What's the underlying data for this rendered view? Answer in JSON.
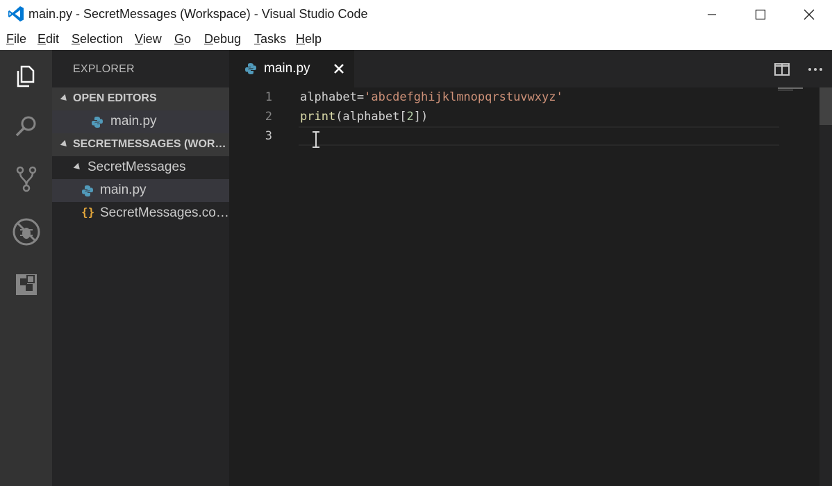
{
  "window": {
    "title": "main.py - SecretMessages (Workspace) - Visual Studio Code"
  },
  "menu": {
    "items": [
      {
        "first": "F",
        "rest": "ile"
      },
      {
        "first": "E",
        "rest": "dit"
      },
      {
        "first": "S",
        "rest": "election"
      },
      {
        "first": "V",
        "rest": "iew"
      },
      {
        "first": "G",
        "rest": "o"
      },
      {
        "first": "D",
        "rest": "ebug"
      },
      {
        "first": "T",
        "rest": "asks"
      },
      {
        "first": "H",
        "rest": "elp"
      }
    ]
  },
  "sidebar": {
    "title": "EXPLORER",
    "open_editors": {
      "header": "OPEN EDITORS",
      "files": [
        "main.py"
      ]
    },
    "workspace": {
      "header": "SECRETMESSAGES (WORKSPACE)",
      "folder": "SecretMessages",
      "files": [
        "main.py",
        "SecretMessages.code-workspace"
      ]
    }
  },
  "editor": {
    "tab_label": "main.py",
    "lines": [
      {
        "num": "1",
        "var": "alphabet",
        "op": "=",
        "str": "'abcdefghijklmnopqrstuvwxyz'"
      },
      {
        "num": "2",
        "fn": "print",
        "open": "(alphabet[",
        "num_lit": "2",
        "close": "])"
      },
      {
        "num": "3"
      }
    ]
  },
  "colors": {
    "activity_bar": "#333333",
    "sidebar": "#252526",
    "editor_bg": "#1e1e1e",
    "string": "#ce9178",
    "python_icon": "#519aba",
    "json_icon": "#e5a83b"
  },
  "icons": {
    "activity": [
      "files-icon",
      "search-icon",
      "source-control-icon",
      "debug-icon",
      "extensions-icon"
    ],
    "file_python": "python-file-icon",
    "file_json": "json-file-icon"
  }
}
